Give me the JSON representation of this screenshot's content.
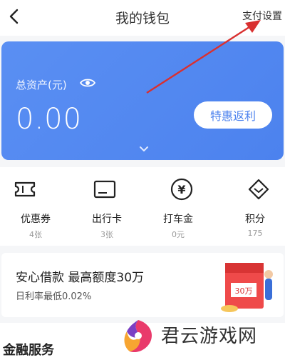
{
  "navbar": {
    "title": "我的钱包",
    "right_action": "支付设置"
  },
  "asset_card": {
    "label": "总资产(元)",
    "amount": "0.00",
    "rebate_button": "特惠返利"
  },
  "quick_items": [
    {
      "name": "优惠券",
      "sub": "4张",
      "icon": "coupon-icon"
    },
    {
      "name": "出行卡",
      "sub": "3张",
      "icon": "card-icon"
    },
    {
      "name": "打车金",
      "sub": "0元",
      "icon": "yen-icon"
    },
    {
      "name": "积分",
      "sub": "175",
      "icon": "diamond-icon"
    }
  ],
  "loan": {
    "title": "安心借款  最高额度30万",
    "subtitle": "日利率最低0.02%",
    "badge": "30万"
  },
  "section": {
    "title": "金融服务"
  },
  "watermark": {
    "text": "君云游戏网"
  },
  "colors": {
    "card_blue": "#4c82ee",
    "annotation_red": "#d93030"
  }
}
